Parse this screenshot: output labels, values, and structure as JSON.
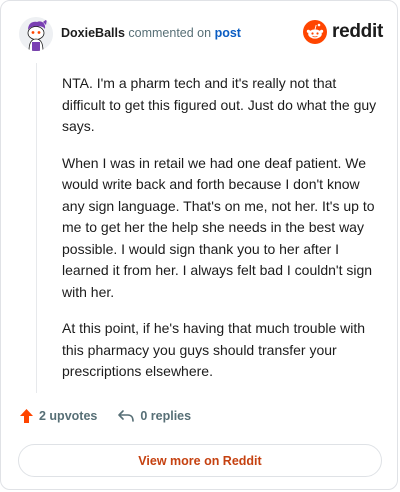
{
  "header": {
    "username": "DoxieBalls",
    "action_text": "commented on",
    "post_link": "post",
    "brand": "reddit"
  },
  "comment": {
    "paragraphs": [
      "NTA. I'm a pharm tech and it's really not that difficult to get this figured out. Just do what the guy says.",
      "When I was in retail we had one deaf patient. We would write back and forth because I don't know any sign language. That's on me, not her. It's up to me to get her the help she needs in the best way possible. I would sign thank you to her after I learned it from her. I always felt bad I couldn't sign with her.",
      "At this point, if he's having that much trouble with this pharmacy you guys should transfer your prescriptions elsewhere."
    ]
  },
  "actions": {
    "upvotes": "2 upvotes",
    "replies": "0 replies"
  },
  "footer": {
    "view_more": "View more on Reddit"
  },
  "colors": {
    "brand_orange": "#ff4500",
    "link_blue": "#0a5cc2",
    "view_more_text": "#c54110",
    "muted": "#576f76"
  }
}
